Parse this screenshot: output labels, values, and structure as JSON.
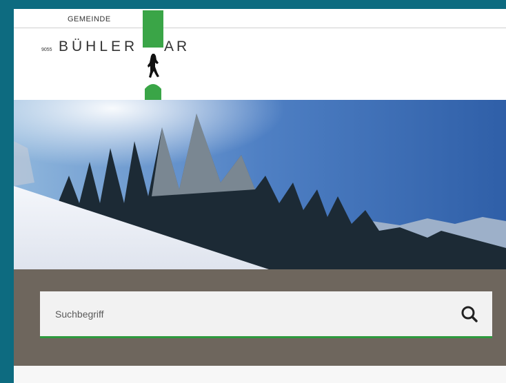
{
  "logo": {
    "top_text": "GEMEINDE",
    "zip": "9055",
    "name": "BÜHLER",
    "canton": "AR",
    "alt": "Gemeinde Bühler AR"
  },
  "search": {
    "placeholder": "Suchbegriff",
    "button_icon": "search-icon"
  },
  "colors": {
    "frame": "#0d6b80",
    "band": "#6e665d",
    "accent": "#2d9a3d"
  }
}
